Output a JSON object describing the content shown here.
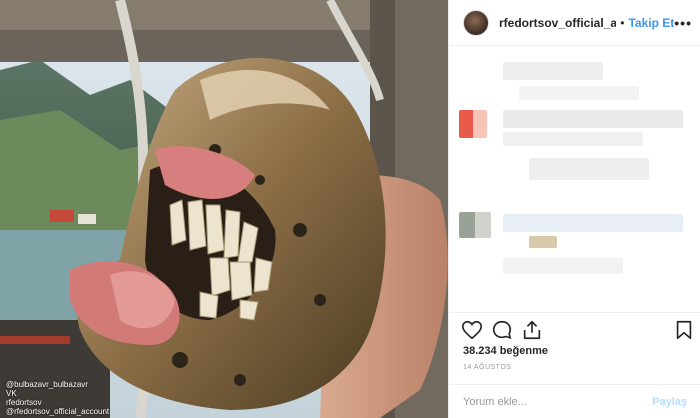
{
  "photo": {
    "credits": [
      "@bulbazavr_bulbazavr",
      "VK",
      "rfedortsov",
      "@rfedortsov_official_account"
    ]
  },
  "header": {
    "username": "rfedortsov_official_accou",
    "separator": "•",
    "follow_label": "Takip Et",
    "more_label": "•••"
  },
  "actions": {
    "like_icon": "heart-icon",
    "comment_icon": "comment-icon",
    "share_icon": "share-icon",
    "save_icon": "bookmark-icon"
  },
  "stats": {
    "likes": "38.234 beğenme",
    "date": "14 AĞUSTOS"
  },
  "add_comment": {
    "placeholder": "Yorum ekle...",
    "post_label": "Paylaş"
  },
  "colors": {
    "accent": "#3897f0",
    "post_disabled": "#b2dffc",
    "text": "#262626",
    "muted": "#999999"
  }
}
